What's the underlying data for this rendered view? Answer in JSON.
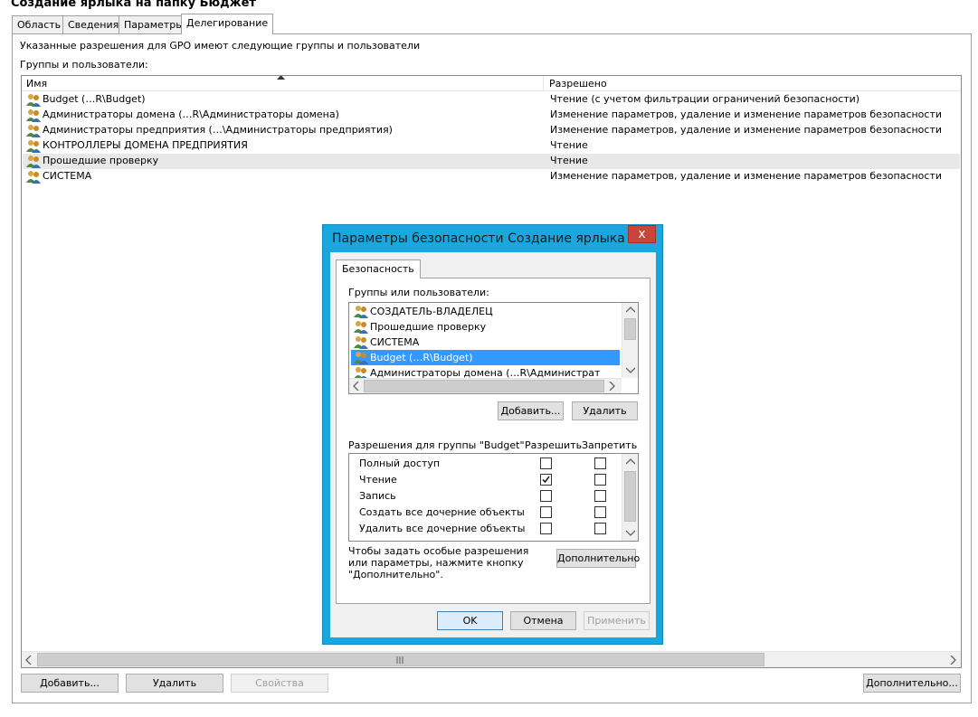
{
  "header": {
    "title": "Создание ярлыка на папку Бюджет"
  },
  "tabs": [
    {
      "label": "Область"
    },
    {
      "label": "Сведения"
    },
    {
      "label": "Параметры"
    },
    {
      "label": "Делегирование",
      "active": true
    }
  ],
  "delegation": {
    "description": "Указанные разрешения для GPO имеют следующие группы и пользователи",
    "groups_label": "Группы и пользователи:",
    "columns": {
      "name": "Имя",
      "permission": "Разрешено"
    },
    "rows": [
      {
        "name": "Budget (…R\\Budget)",
        "permission": "Чтение (с учетом фильтрации ограничений безопасности)"
      },
      {
        "name": "Администраторы домена (…R\\Администраторы домена)",
        "permission": "Изменение параметров, удаление и изменение параметров безопасности"
      },
      {
        "name": "Администраторы предприятия (…\\Администраторы предприятия)",
        "permission": "Изменение параметров, удаление и изменение параметров безопасности"
      },
      {
        "name": "КОНТРОЛЛЕРЫ ДОМЕНА ПРЕДПРИЯТИЯ",
        "permission": "Чтение"
      },
      {
        "name": "Прошедшие проверку",
        "permission": "Чтение",
        "selected": true
      },
      {
        "name": "СИСТЕМА",
        "permission": "Изменение параметров, удаление и изменение параметров безопасности"
      }
    ],
    "buttons": {
      "add": "Добавить...",
      "remove": "Удалить",
      "properties": "Свойства",
      "advanced": "Дополнительно..."
    }
  },
  "dialog": {
    "title": "Параметры безопасности Создание ярлыка ...",
    "close_glyph": "x",
    "tab": "Безопасность",
    "groups_label": "Группы или пользователи:",
    "users": [
      {
        "name": "СОЗДАТЕЛЬ-ВЛАДЕЛЕЦ"
      },
      {
        "name": "Прошедшие проверку"
      },
      {
        "name": "СИСТЕМА"
      },
      {
        "name": "Budget (…R\\Budget)",
        "selected": true
      },
      {
        "name": "Администраторы домена (…R\\Администрат"
      }
    ],
    "add_button": "Добавить...",
    "remove_button": "Удалить",
    "perm_header": "Разрешения для группы \"Budget\"",
    "allow_header": "Разрешить",
    "deny_header": "Запретить",
    "permissions": [
      {
        "name": "Полный доступ",
        "allow": false,
        "deny": false
      },
      {
        "name": "Чтение",
        "allow": true,
        "deny": false
      },
      {
        "name": "Запись",
        "allow": false,
        "deny": false
      },
      {
        "name": "Создать все дочерние объекты",
        "allow": false,
        "deny": false
      },
      {
        "name": "Удалить все дочерние объекты",
        "allow": false,
        "deny": false
      }
    ],
    "advanced_text": "Чтобы задать особые разрешения или параметры, нажмите кнопку \"Дополнительно\".",
    "advanced_button": "Дополнительно",
    "ok": "OK",
    "cancel": "Отмена",
    "apply": "Применить"
  },
  "icons": {
    "user_group": "user-group-icon",
    "sort_up": "sort-ascending-icon",
    "scroll_left": "chevron-left-icon",
    "scroll_right": "chevron-right-icon",
    "scroll_up": "chevron-up-icon",
    "scroll_down": "chevron-down-icon",
    "checkbox_checked": "checkmark-icon"
  },
  "colors": {
    "dialog_frame": "#1aa7e0",
    "close_button": "#c7463c",
    "selection": "#3399ff"
  }
}
